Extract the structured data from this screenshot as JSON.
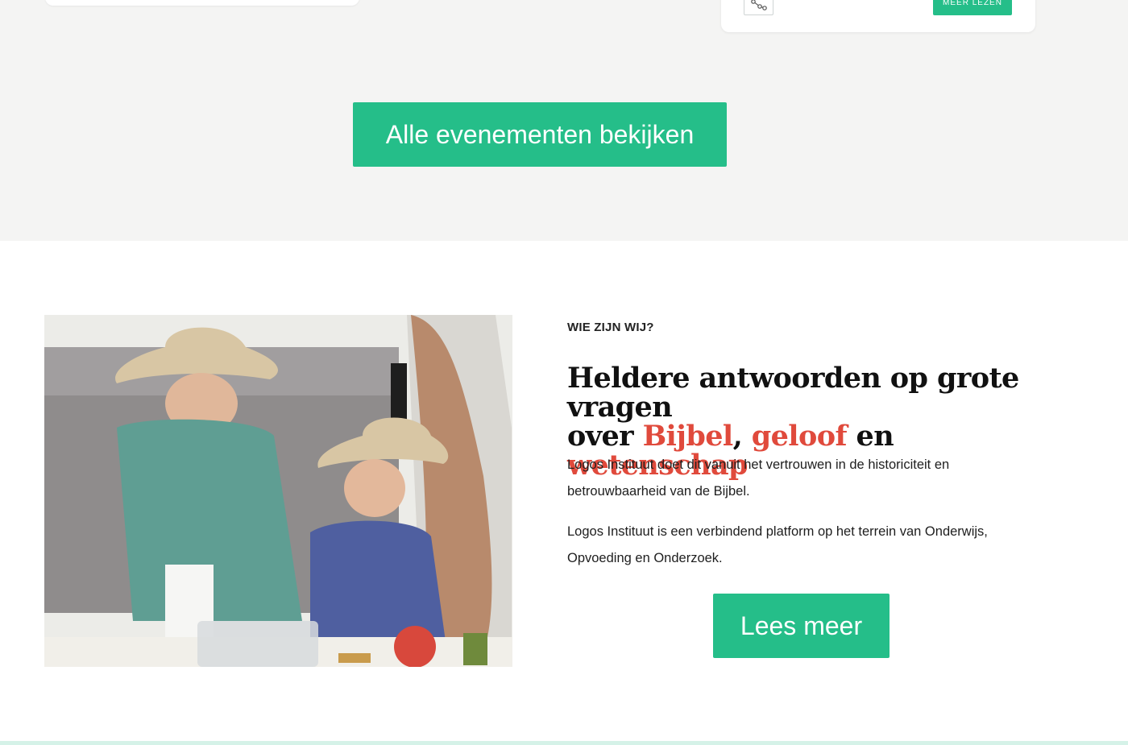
{
  "events_section": {
    "card_right": {
      "share_icon": "share-icon",
      "read_more_label": "MEER LEZEN"
    },
    "all_events_button_label": "Alle evenementen bekijken"
  },
  "about_section": {
    "eyebrow": "WIE ZIJN WIJ?",
    "headline": {
      "line1": "Heldere antwoorden op grote vragen",
      "line2_prefix": "over ",
      "highlight1": "Bijbel",
      "comma": ",",
      "highlight2": "geloof",
      "connector": " en ",
      "highlight3": "wetenschap"
    },
    "paragraph1": "Logos Instituut doet dit vanuit het vertrouwen in de historiciteit en betrouwbaarheid van de Bijbel.",
    "paragraph2": "Logos Instituut is een verbindend platform op het terrein van Onderwijs, Opvoeding en Onderzoek.",
    "read_more_button_label": "Lees meer"
  },
  "colors": {
    "accent_green": "#25be89",
    "highlight_red": "#e04a3c",
    "section_background": "#f4f4f3"
  }
}
